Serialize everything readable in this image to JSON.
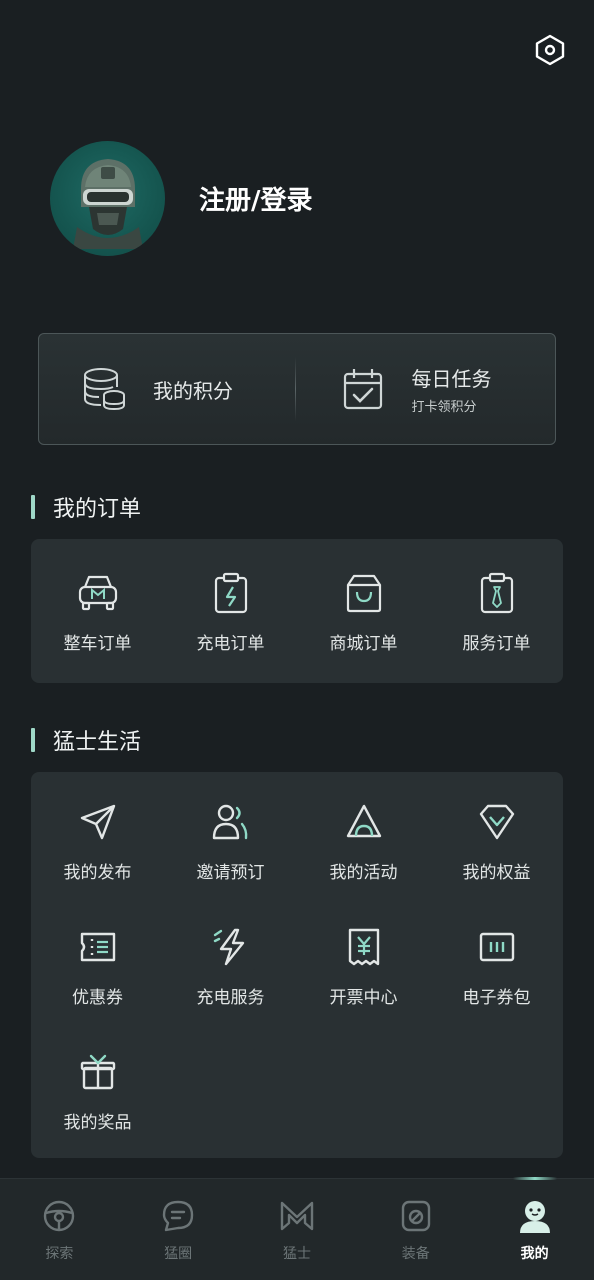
{
  "header": {
    "settings_icon": "hexagon-settings-icon"
  },
  "profile": {
    "login_label": "注册/登录",
    "avatar_icon": "helmet-avatar-icon"
  },
  "points_card": {
    "points_label": "我的积分",
    "task_title": "每日任务",
    "task_subtitle": "打卡领积分"
  },
  "orders": {
    "title": "我的订单",
    "items": [
      {
        "label": "整车订单",
        "icon": "car-order-icon"
      },
      {
        "label": "充电订单",
        "icon": "charge-order-icon"
      },
      {
        "label": "商城订单",
        "icon": "shopping-bag-icon"
      },
      {
        "label": "服务订单",
        "icon": "service-order-icon"
      }
    ]
  },
  "life": {
    "title": "猛士生活",
    "items": [
      {
        "label": "我的发布",
        "icon": "send-icon"
      },
      {
        "label": "邀请预订",
        "icon": "invite-users-icon"
      },
      {
        "label": "我的活动",
        "icon": "tent-icon"
      },
      {
        "label": "我的权益",
        "icon": "diamond-icon"
      },
      {
        "label": "优惠券",
        "icon": "coupon-icon"
      },
      {
        "label": "充电服务",
        "icon": "lightning-icon"
      },
      {
        "label": "开票中心",
        "icon": "invoice-icon"
      },
      {
        "label": "电子券包",
        "icon": "voucher-wallet-icon"
      },
      {
        "label": "我的奖品",
        "icon": "gift-icon"
      }
    ]
  },
  "tabbar": {
    "tabs": [
      {
        "label": "探索",
        "icon": "steering-wheel-icon",
        "active": false
      },
      {
        "label": "猛圈",
        "icon": "chat-bubble-icon",
        "active": false
      },
      {
        "label": "猛士",
        "icon": "m-logo-icon",
        "active": false
      },
      {
        "label": "装备",
        "icon": "equipment-icon",
        "active": false
      },
      {
        "label": "我的",
        "icon": "profile-icon",
        "active": true
      }
    ]
  },
  "colors": {
    "accent": "#9fd8c8",
    "background": "#1a1f22",
    "panel": "#293033"
  }
}
